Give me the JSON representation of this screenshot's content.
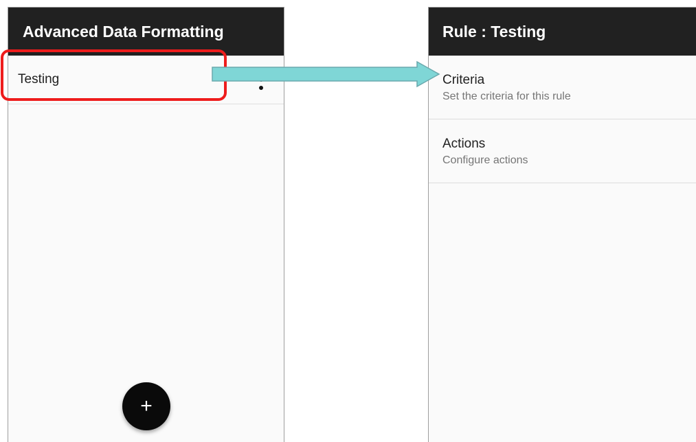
{
  "left_screen": {
    "appbar_title": "Advanced Data Formatting",
    "rules": [
      {
        "label": "Testing"
      }
    ],
    "fab_label": "+"
  },
  "right_screen": {
    "appbar_title": "Rule : Testing",
    "items": [
      {
        "title": "Criteria",
        "summary": "Set the criteria for this rule"
      },
      {
        "title": "Actions",
        "summary": "Configure actions"
      }
    ]
  },
  "annotation": {
    "highlight_color": "#ee1c1c",
    "arrow_fill": "#7fd6d6",
    "arrow_stroke": "#6aa9ad"
  },
  "colors": {
    "appbar": "#212121",
    "background": "#fafafa",
    "fab": "#0a0a0a"
  }
}
